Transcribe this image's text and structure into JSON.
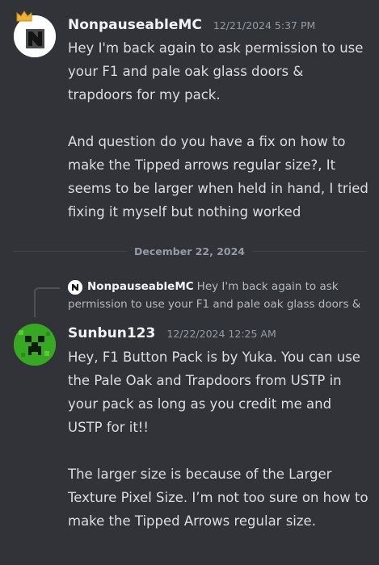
{
  "messages": [
    {
      "username": "NonpauseableMC",
      "timestamp": "12/21/2024 5:37 PM",
      "avatar_icon": "nonpauseable-n-logo-avatar",
      "paragraphs": [
        "Hey I'm back again to ask permission to use your F1 and pale oak glass doors & trapdoors for my pack.",
        "And question do you have a fix on how to make the Tipped arrows regular size?, It seems to be larger when held in hand, I tried fixing it myself but nothing worked"
      ]
    },
    {
      "username": "Sunbun123",
      "timestamp": "12/22/2024 12:25 AM",
      "avatar_icon": "creeper-face-avatar",
      "reply": {
        "username": "NonpauseableMC",
        "preview": "Hey I'm back again to ask permission to use your F1 and pale oak glass doors &"
      },
      "paragraphs": [
        "Hey, F1 Button Pack is by Yuka. You can use the Pale Oak and Trapdoors from USTP in your pack as long as you credit me and USTP for it!!",
        "The larger size is because of the Larger Texture Pixel Size. I’m not too sure on how to make the Tipped Arrows regular size."
      ]
    }
  ],
  "date_divider": "December 22, 2024",
  "colors": {
    "background": "#313338",
    "username": "#f2f3f5",
    "body_text": "#dbdee1",
    "muted_text": "#949ba4",
    "creeper_green": "#36a821"
  }
}
